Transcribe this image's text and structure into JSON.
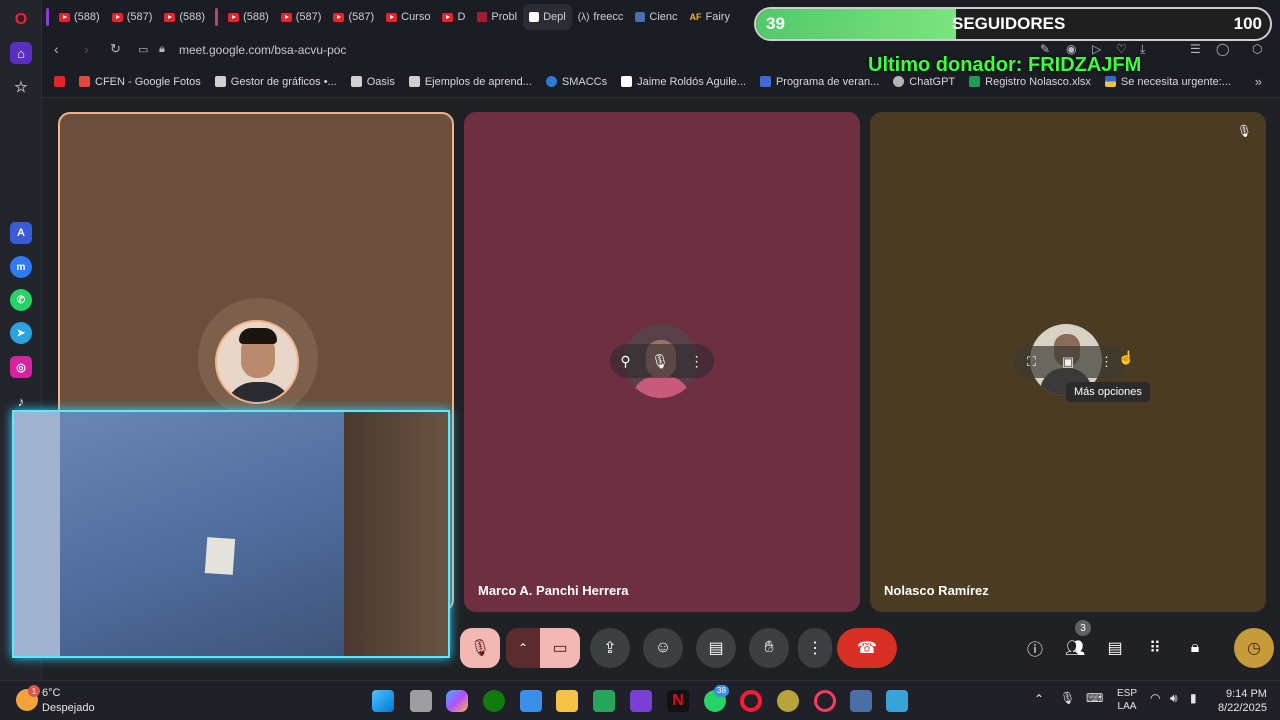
{
  "tabs": [
    {
      "label": "(588)",
      "icon": "youtube-icon"
    },
    {
      "label": "(587)",
      "icon": "youtube-icon"
    },
    {
      "label": "(588)",
      "icon": "youtube-icon"
    },
    {
      "label": "(588)",
      "icon": "youtube-icon"
    },
    {
      "label": "(587)",
      "icon": "youtube-icon"
    },
    {
      "label": "(587)",
      "icon": "youtube-icon"
    },
    {
      "label": "Curso",
      "icon": "youtube-icon"
    },
    {
      "label": "D",
      "icon": "youtube-icon"
    },
    {
      "label": "Probl",
      "icon": "harvard-icon"
    },
    {
      "label": "Depl",
      "icon": "app-icon"
    },
    {
      "label": "freecc",
      "icon": "freecodecamp-icon"
    },
    {
      "label": "Cienc",
      "icon": "university-icon"
    },
    {
      "label": "Fairy",
      "icon": "af-icon"
    }
  ],
  "address": {
    "url": "meet.google.com/bsa-acvu-poc"
  },
  "bookmarks": [
    {
      "label": "CFEN - Google Fotos",
      "color": "#e8453c"
    },
    {
      "label": "Gestor de gráficos •...",
      "color": "#d0d0d0"
    },
    {
      "label": "Oasis",
      "color": "#d0d0d0"
    },
    {
      "label": "Ejemplos de aprend...",
      "color": "#d0d0d0"
    },
    {
      "label": "SMACCs",
      "color": "#2b7bd9"
    },
    {
      "label": "Jaime Roldós Aguile...",
      "color": "#ffffff"
    },
    {
      "label": "Programa de veran...",
      "color": "#3f6ad8"
    },
    {
      "label": "ChatGPT",
      "color": "#b5b5b5"
    },
    {
      "label": "Registro Nolasco.xlsx",
      "color": "#1f9d55"
    },
    {
      "label": "Se necesita urgente:...",
      "color": "#f4c430"
    }
  ],
  "overlay": {
    "followers_count": "39",
    "followers_label": "SEGUIDORES",
    "followers_goal": "100",
    "progress_fraction": 0.39,
    "donor_text": "Ultimo donador: FRIDZAJFM"
  },
  "participants": [
    {
      "name": "Marco A. Panchi Herrera"
    },
    {
      "name": "Nolasco Ramírez"
    }
  ],
  "tooltip": "Más opciones",
  "people_count": "3",
  "colors": {
    "tile1": "#6b4f3c",
    "tile2": "#6e3040",
    "tile3": "#4a3b22",
    "end_call": "#d93025",
    "meet_bg": "#202124"
  },
  "taskbar": {
    "weather_temp": "6°C",
    "weather_desc": "Despejado",
    "weather_badge": "1",
    "whatsapp_badge": "38",
    "lang_line1": "ESP",
    "lang_line2": "LAA",
    "time": "9:14 PM",
    "date": "8/22/2025"
  }
}
